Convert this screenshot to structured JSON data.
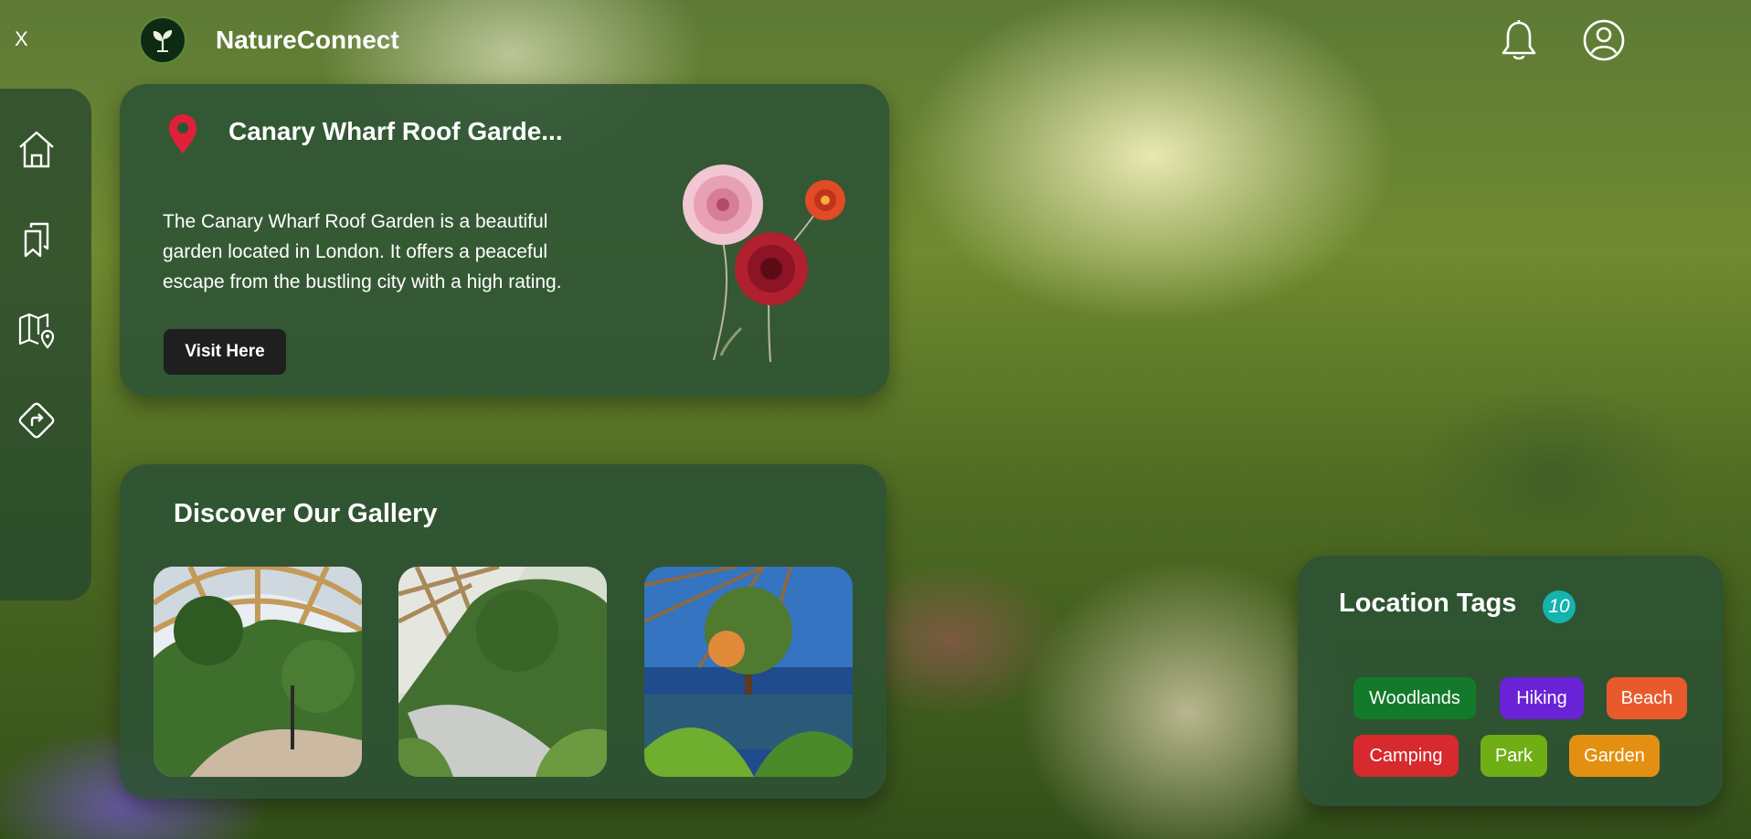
{
  "app": {
    "close_label": "X",
    "name": "NatureConnect"
  },
  "header": {
    "icons": [
      "bell-icon",
      "user-circle-icon"
    ]
  },
  "sidebar": {
    "items": [
      {
        "icon": "home-icon"
      },
      {
        "icon": "bookmarks-icon"
      },
      {
        "icon": "map-pin-icon"
      },
      {
        "icon": "directions-icon"
      }
    ]
  },
  "featured": {
    "icon": "location-pin-icon",
    "title": "Canary Wharf Roof Garde...",
    "description": "The Canary Wharf Roof Garden is a beautiful garden located in London. It offers a peaceful escape from the bustling city with a high rating.",
    "button_label": "Visit Here"
  },
  "gallery": {
    "title": "Discover Our Gallery",
    "images": [
      "garden-dome-photo",
      "garden-walkway-photo",
      "garden-pond-photo"
    ]
  },
  "tags": {
    "title": "Location Tags",
    "count": "10",
    "items": [
      {
        "label": "Woodlands",
        "color": "#137a2b"
      },
      {
        "label": "Hiking",
        "color": "#6a22d6"
      },
      {
        "label": "Beach",
        "color": "#e85a2c"
      },
      {
        "label": "Camping",
        "color": "#d62a2e"
      },
      {
        "label": "Park",
        "color": "#6fae15"
      },
      {
        "label": "Garden",
        "color": "#e39012"
      }
    ]
  },
  "colors": {
    "panel": "#2c5234",
    "button": "#1e1f1e",
    "pin": "#e0203a",
    "badge": "#14b3ad"
  }
}
